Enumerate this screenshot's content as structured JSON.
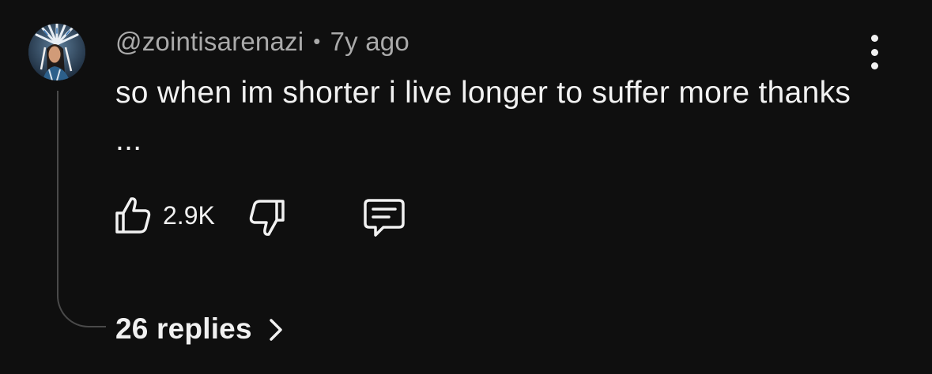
{
  "comment": {
    "author": "@zointisarenazi",
    "separator": "•",
    "timestamp": "7y ago",
    "text": "so when im shorter i live longer to suffer more thanks ...",
    "like_count": "2.9K",
    "replies_label": "26 replies"
  },
  "icons": {
    "avatar": "avatar-image",
    "more": "more-vertical-icon",
    "like": "thumbs-up-icon",
    "dislike": "thumbs-down-icon",
    "reply": "comment-icon",
    "chevron": "chevron-right-icon"
  },
  "colors": {
    "background": "#0f0f0f",
    "primary_text": "#f1f1f1",
    "secondary_text": "#aaaaaa",
    "thread_line": "#4a4a4a"
  }
}
